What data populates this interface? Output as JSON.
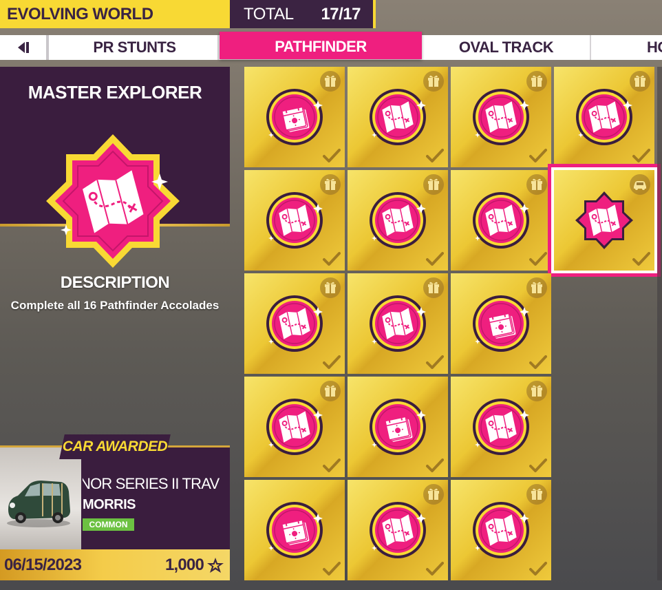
{
  "header": {
    "title": "EVOLVING WORLD",
    "total_label": "TOTAL",
    "total_count": "17/17"
  },
  "tabs": [
    {
      "label": "PR STUNTS"
    },
    {
      "label": "PATHFINDER",
      "active": true
    },
    {
      "label": "OVAL TRACK"
    },
    {
      "label": "HO"
    }
  ],
  "accolade": {
    "title": "MASTER EXPLORER",
    "description_heading": "DESCRIPTION",
    "description": "Complete all 16 Pathfinder Accolades",
    "badge_icon": "map-icon"
  },
  "reward": {
    "tag": "CAR AWARDED",
    "car_name": "NOR SERIES II TRAVELER",
    "car_make": "MORRIS",
    "rarity": "COMMON",
    "date": "06/15/2023",
    "points": "1,000"
  },
  "tiles": [
    {
      "icon": "calendar-icon",
      "reward": "gift-icon",
      "completed": true
    },
    {
      "icon": "map-icon",
      "reward": "gift-icon",
      "completed": true
    },
    {
      "icon": "map-icon",
      "reward": "gift-icon",
      "completed": true
    },
    {
      "icon": "map-icon",
      "reward": "gift-icon",
      "completed": true
    },
    {
      "icon": "map-icon",
      "reward": "gift-icon",
      "completed": true
    },
    {
      "icon": "map-icon",
      "reward": "gift-icon",
      "completed": true
    },
    {
      "icon": "map-icon",
      "reward": "gift-icon",
      "completed": true
    },
    {
      "icon": "map-icon",
      "reward": "car-icon",
      "completed": true,
      "selected": true
    },
    {
      "icon": "map-icon",
      "reward": "gift-icon",
      "completed": true
    },
    {
      "icon": "map-icon",
      "reward": "gift-icon",
      "completed": true
    },
    {
      "icon": "calendar-icon",
      "reward": "gift-icon",
      "completed": true
    },
    {
      "icon": "map-icon",
      "reward": "gift-icon",
      "completed": true
    },
    {
      "icon": "calendar-icon",
      "reward": "",
      "completed": true
    },
    {
      "icon": "map-icon",
      "reward": "gift-icon",
      "completed": true
    },
    {
      "icon": "calendar-icon",
      "reward": "",
      "completed": true
    },
    {
      "icon": "map-icon",
      "reward": "gift-icon",
      "completed": true
    },
    {
      "icon": "map-icon",
      "reward": "gift-icon",
      "completed": true
    }
  ],
  "colors": {
    "accent": "#ef1f7f",
    "gold": "#f8d934",
    "panel": "#3a1d3e",
    "rarity_common": "#6cc142"
  }
}
